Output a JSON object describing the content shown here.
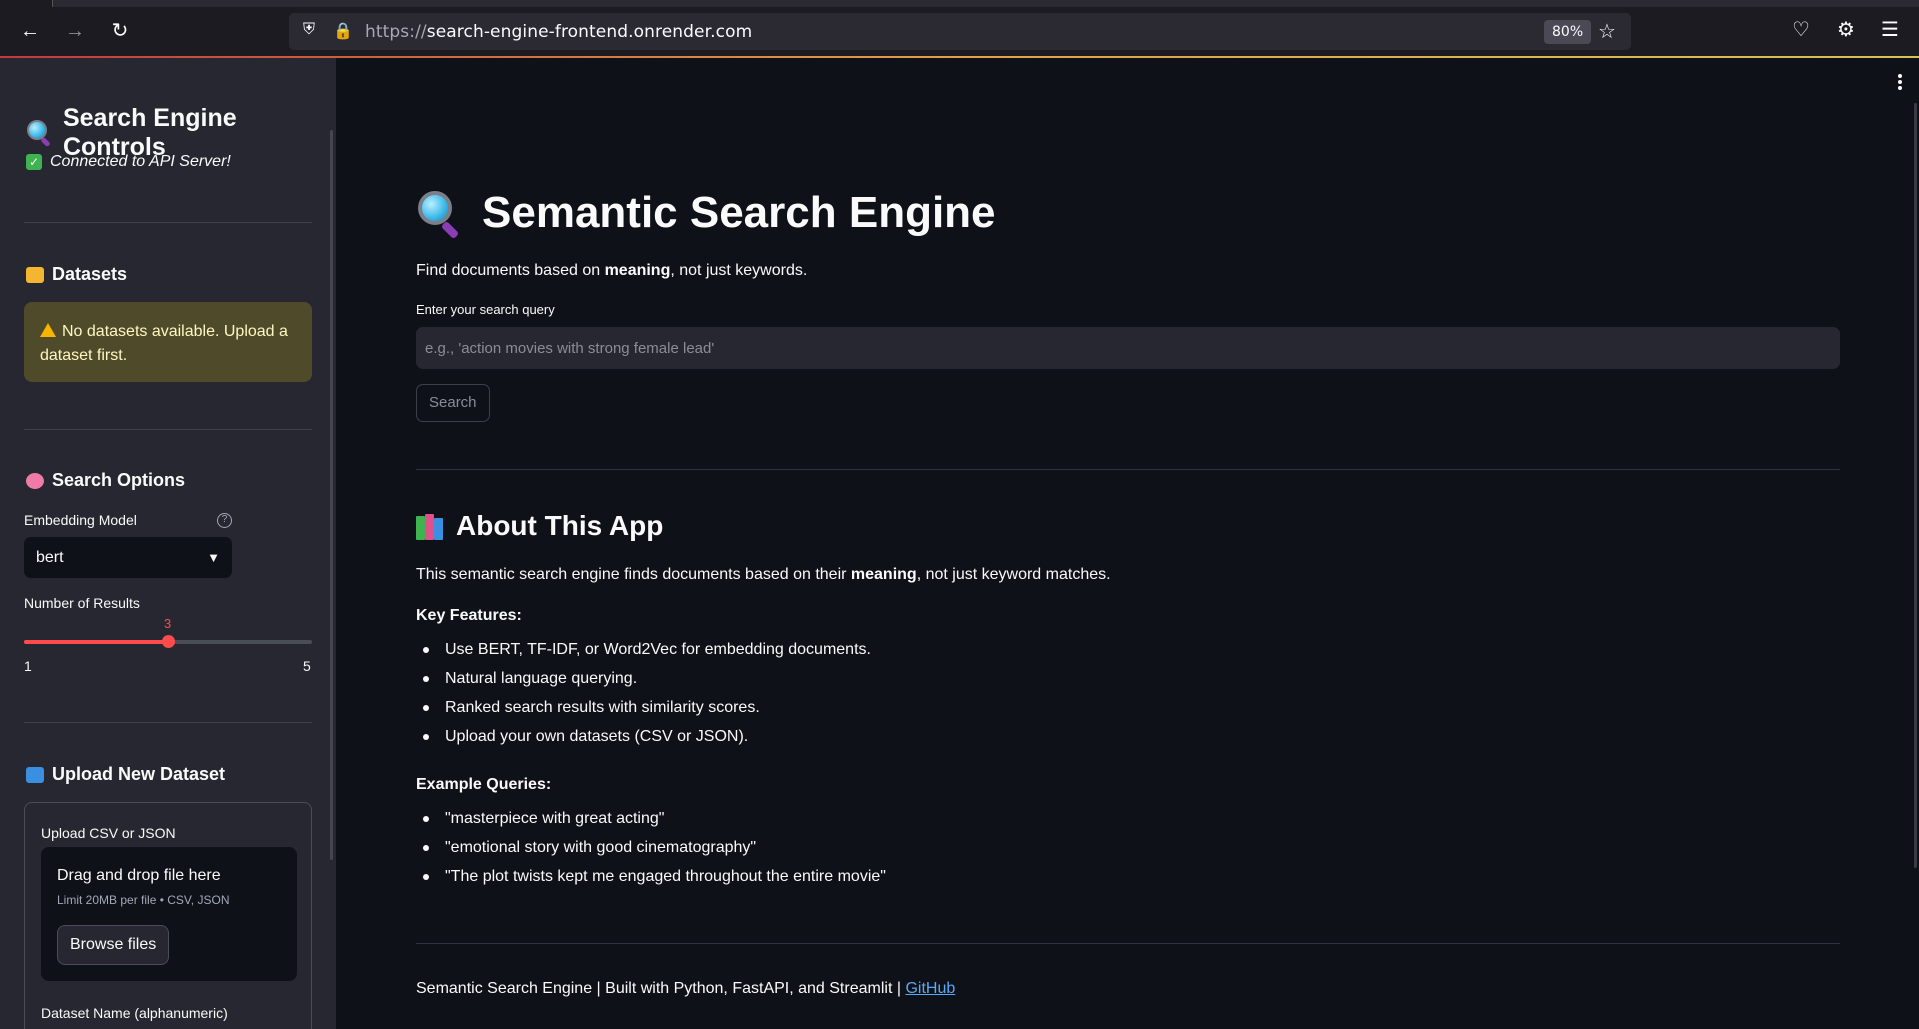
{
  "browser": {
    "url_protocol": "https://",
    "url_host": "search-engine-frontend.onrender.com",
    "zoom": "80%"
  },
  "sidebar": {
    "title": "Search Engine Controls",
    "connection_status": "Connected to API Server!",
    "datasets": {
      "heading": "Datasets",
      "warning": "No datasets available. Upload a dataset first."
    },
    "search_options": {
      "heading": "Search Options",
      "embedding_label": "Embedding Model",
      "embedding_value": "bert",
      "results_label": "Number of Results",
      "results_value": 3,
      "results_min": 1,
      "results_max": 5
    },
    "upload": {
      "heading": "Upload New Dataset",
      "label": "Upload CSV or JSON",
      "drop_title": "Drag and drop file here",
      "drop_limits": "Limit 20MB per file • CSV, JSON",
      "browse_label": "Browse files",
      "dataset_name_label": "Dataset Name (alphanumeric)"
    }
  },
  "main": {
    "title": "Semantic Search Engine",
    "intro_prefix": "Find documents based on ",
    "intro_bold": "meaning",
    "intro_suffix": ", not just keywords.",
    "query_label": "Enter your search query",
    "query_placeholder": "e.g., 'action movies with strong female lead'",
    "search_button": "Search",
    "about": {
      "title": "About This App",
      "desc_prefix": "This semantic search engine finds documents based on their ",
      "desc_bold": "meaning",
      "desc_suffix": ", not just keyword matches.",
      "features_heading": "Key Features:",
      "features": [
        "Use BERT, TF-IDF, or Word2Vec for embedding documents.",
        "Natural language querying.",
        "Ranked search results with similarity scores.",
        "Upload your own datasets (CSV or JSON)."
      ],
      "examples_heading": "Example Queries:",
      "examples": [
        "\"masterpiece with great acting\"",
        "\"emotional story with good cinematography\"",
        "\"The plot twists kept me engaged throughout the entire movie\""
      ]
    },
    "footer_text": "Semantic Search Engine | Built with Python, FastAPI, and Streamlit | ",
    "footer_link": "GitHub"
  },
  "colors": {
    "accent": "#ff4b4b",
    "background": "#0e1117",
    "sidebar_bg": "#262730",
    "link": "#5aa9f5"
  }
}
